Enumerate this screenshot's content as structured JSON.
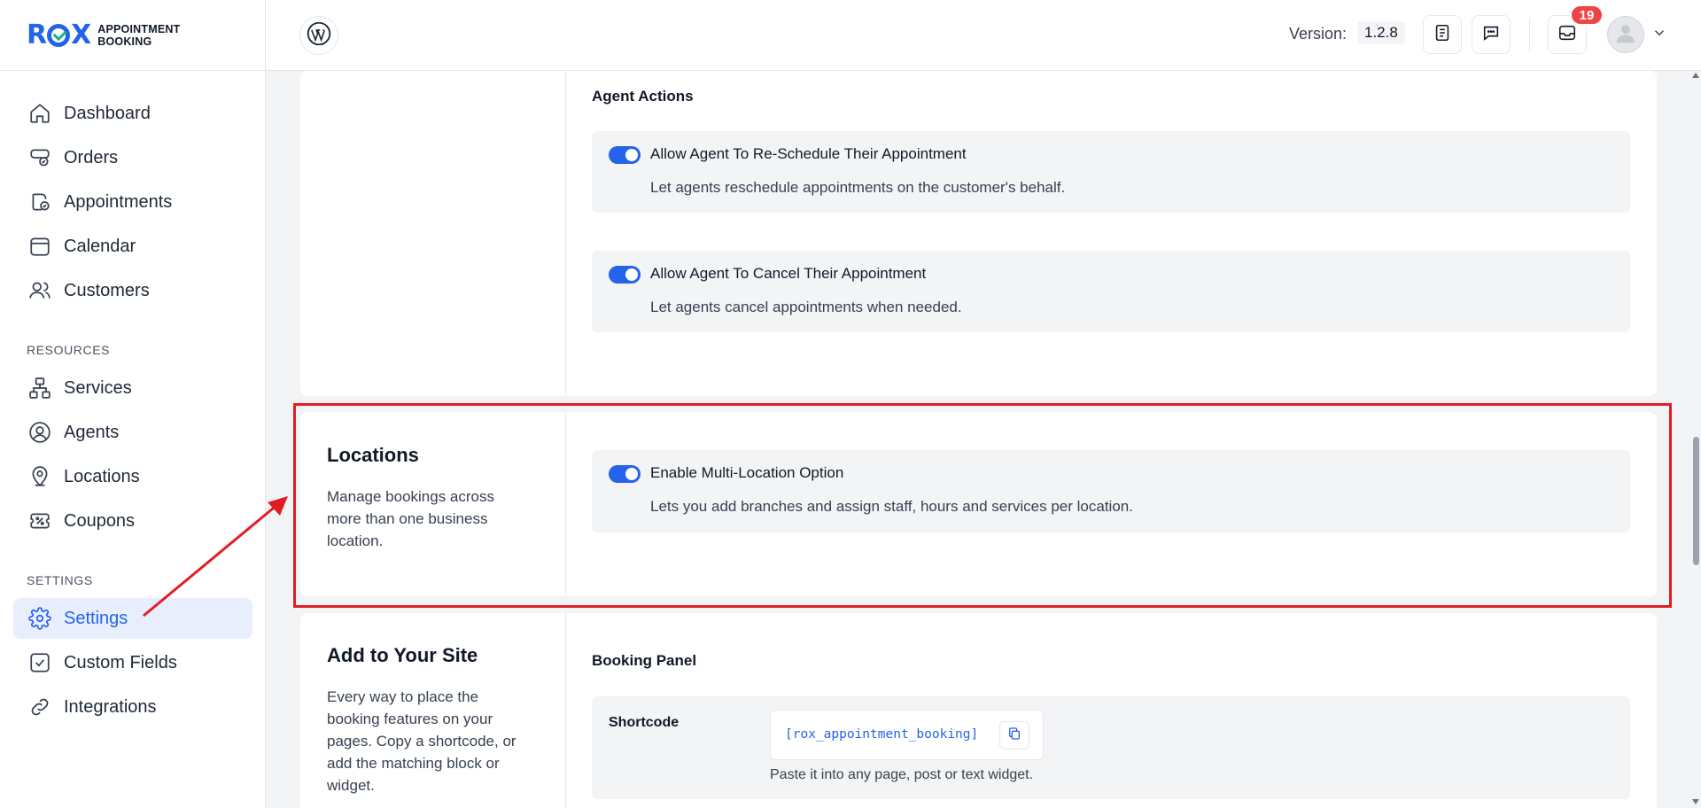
{
  "brand": {
    "mark": "ROX",
    "line1": "APPOINTMENT",
    "line2": "BOOKING",
    "accent": "#2563eb"
  },
  "sidebar": {
    "items": [
      {
        "label": "Dashboard",
        "icon": "home-icon"
      },
      {
        "label": "Orders",
        "icon": "orders-icon"
      },
      {
        "label": "Appointments",
        "icon": "appointments-icon"
      },
      {
        "label": "Calendar",
        "icon": "calendar-icon"
      },
      {
        "label": "Customers",
        "icon": "customers-icon"
      }
    ],
    "resources_heading": "RESOURCES",
    "resources": [
      {
        "label": "Services",
        "icon": "services-icon"
      },
      {
        "label": "Agents",
        "icon": "agents-icon"
      },
      {
        "label": "Locations",
        "icon": "location-pin-icon"
      },
      {
        "label": "Coupons",
        "icon": "coupon-icon"
      }
    ],
    "settings_heading": "SETTINGS",
    "settings": [
      {
        "label": "Settings",
        "icon": "gear-icon",
        "active": true
      },
      {
        "label": "Custom Fields",
        "icon": "checkbox-icon"
      },
      {
        "label": "Integrations",
        "icon": "link-icon"
      }
    ]
  },
  "header": {
    "version_label": "Version:",
    "version_value": "1.2.8",
    "notifications_count": "19"
  },
  "agent_actions": {
    "heading": "Agent Actions",
    "options": [
      {
        "label": "Allow Agent To Re-Schedule Their Appointment",
        "desc": "Let agents reschedule appointments on the customer's behalf.",
        "enabled": true
      },
      {
        "label": "Allow Agent To Cancel Their Appointment",
        "desc": "Let agents cancel appointments when needed.",
        "enabled": true
      }
    ]
  },
  "locations": {
    "title": "Locations",
    "desc": "Manage bookings across more than one business location.",
    "option_label": "Enable Multi-Location Option",
    "option_desc": "Lets you add branches and assign staff, hours and services per location.",
    "enabled": true
  },
  "add_to_site": {
    "title": "Add to Your Site",
    "desc": "Every way to place the booking features on your pages. Copy a shortcode, or add the matching block or widget.",
    "panel_heading": "Booking Panel",
    "shortcode_label": "Shortcode",
    "shortcode_value": "[rox_appointment_booking]",
    "shortcode_help": "Paste it into any page, post or text widget."
  },
  "annotation_color": "#e11d24"
}
